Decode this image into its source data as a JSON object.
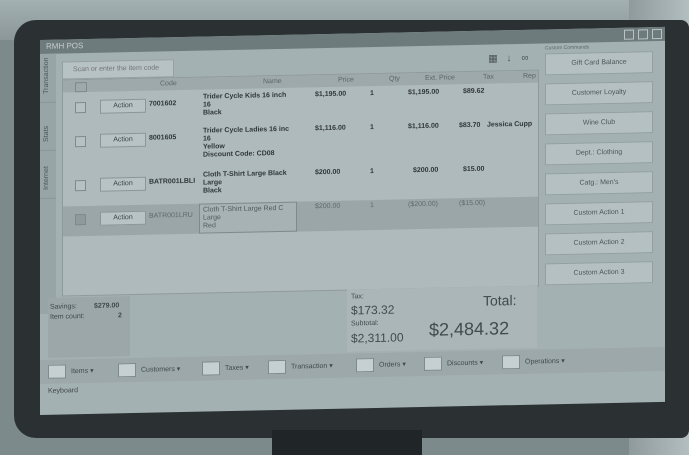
{
  "window": {
    "title": "RMH POS"
  },
  "side_tabs": [
    "Transaction",
    "Stats",
    "Internet"
  ],
  "search": {
    "placeholder": "Scan or enter the item code"
  },
  "grid": {
    "headers": [
      "Code",
      "Name",
      "Price",
      "Qty",
      "Ext. Price",
      "Tax",
      "Rep"
    ],
    "action_label": "Action",
    "rows": [
      {
        "code": "7001602",
        "name": [
          "Trider Cycle Kids 16 inch",
          "16",
          "Black"
        ],
        "price": "$1,195.00",
        "qty": "1",
        "ext": "$1,195.00",
        "tax": "$89.62",
        "rep": "",
        "checked": false,
        "selected": false
      },
      {
        "code": "8001605",
        "name": [
          "Trider Cycle Ladies 16 inc",
          "16",
          "Yellow",
          "Discount Code: CD08"
        ],
        "price": "$1,116.00",
        "qty": "1",
        "ext": "$1,116.00",
        "tax": "$83.70",
        "rep": "Jessica Cupp",
        "checked": false,
        "selected": false
      },
      {
        "code": "BATR001LBLI",
        "name": [
          "Cloth T-Shirt Large Black",
          "Large",
          "Black"
        ],
        "price": "$200.00",
        "qty": "1",
        "ext": "$200.00",
        "tax": "$15.00",
        "rep": "",
        "checked": false,
        "selected": false
      },
      {
        "code": "BATR001LRU",
        "name": [
          "Cloth T-Shirt Large Red C",
          "Large",
          "Red"
        ],
        "price": "$200.00",
        "qty": "1",
        "ext": "($200.00)",
        "tax": "($15.00)",
        "rep": "",
        "checked": true,
        "selected": true
      }
    ]
  },
  "summary": {
    "savings_label": "Savings:",
    "savings": "$279.00",
    "count_label": "Item count:",
    "count": "2"
  },
  "totals": {
    "tax_label": "Tax:",
    "tax": "$173.32",
    "subtotal_label": "Subtotal:",
    "subtotal": "$2,311.00",
    "total_label": "Total:",
    "total": "$2,484.32"
  },
  "right_panel": {
    "label": "Custom Commands",
    "buttons": [
      "Gift Card Balance",
      "Customer Loyalty",
      "Wine Club",
      "Dept.: Clothing",
      "Catg.: Men's",
      "Custom Action 1",
      "Custom Action 2",
      "Custom Action 3"
    ]
  },
  "toolbar": {
    "items": [
      "Items",
      "Customers",
      "Taxes",
      "Transaction",
      "Orders",
      "Discounts",
      "Operations"
    ]
  },
  "footer": {
    "keyboard": "Keyboard"
  }
}
